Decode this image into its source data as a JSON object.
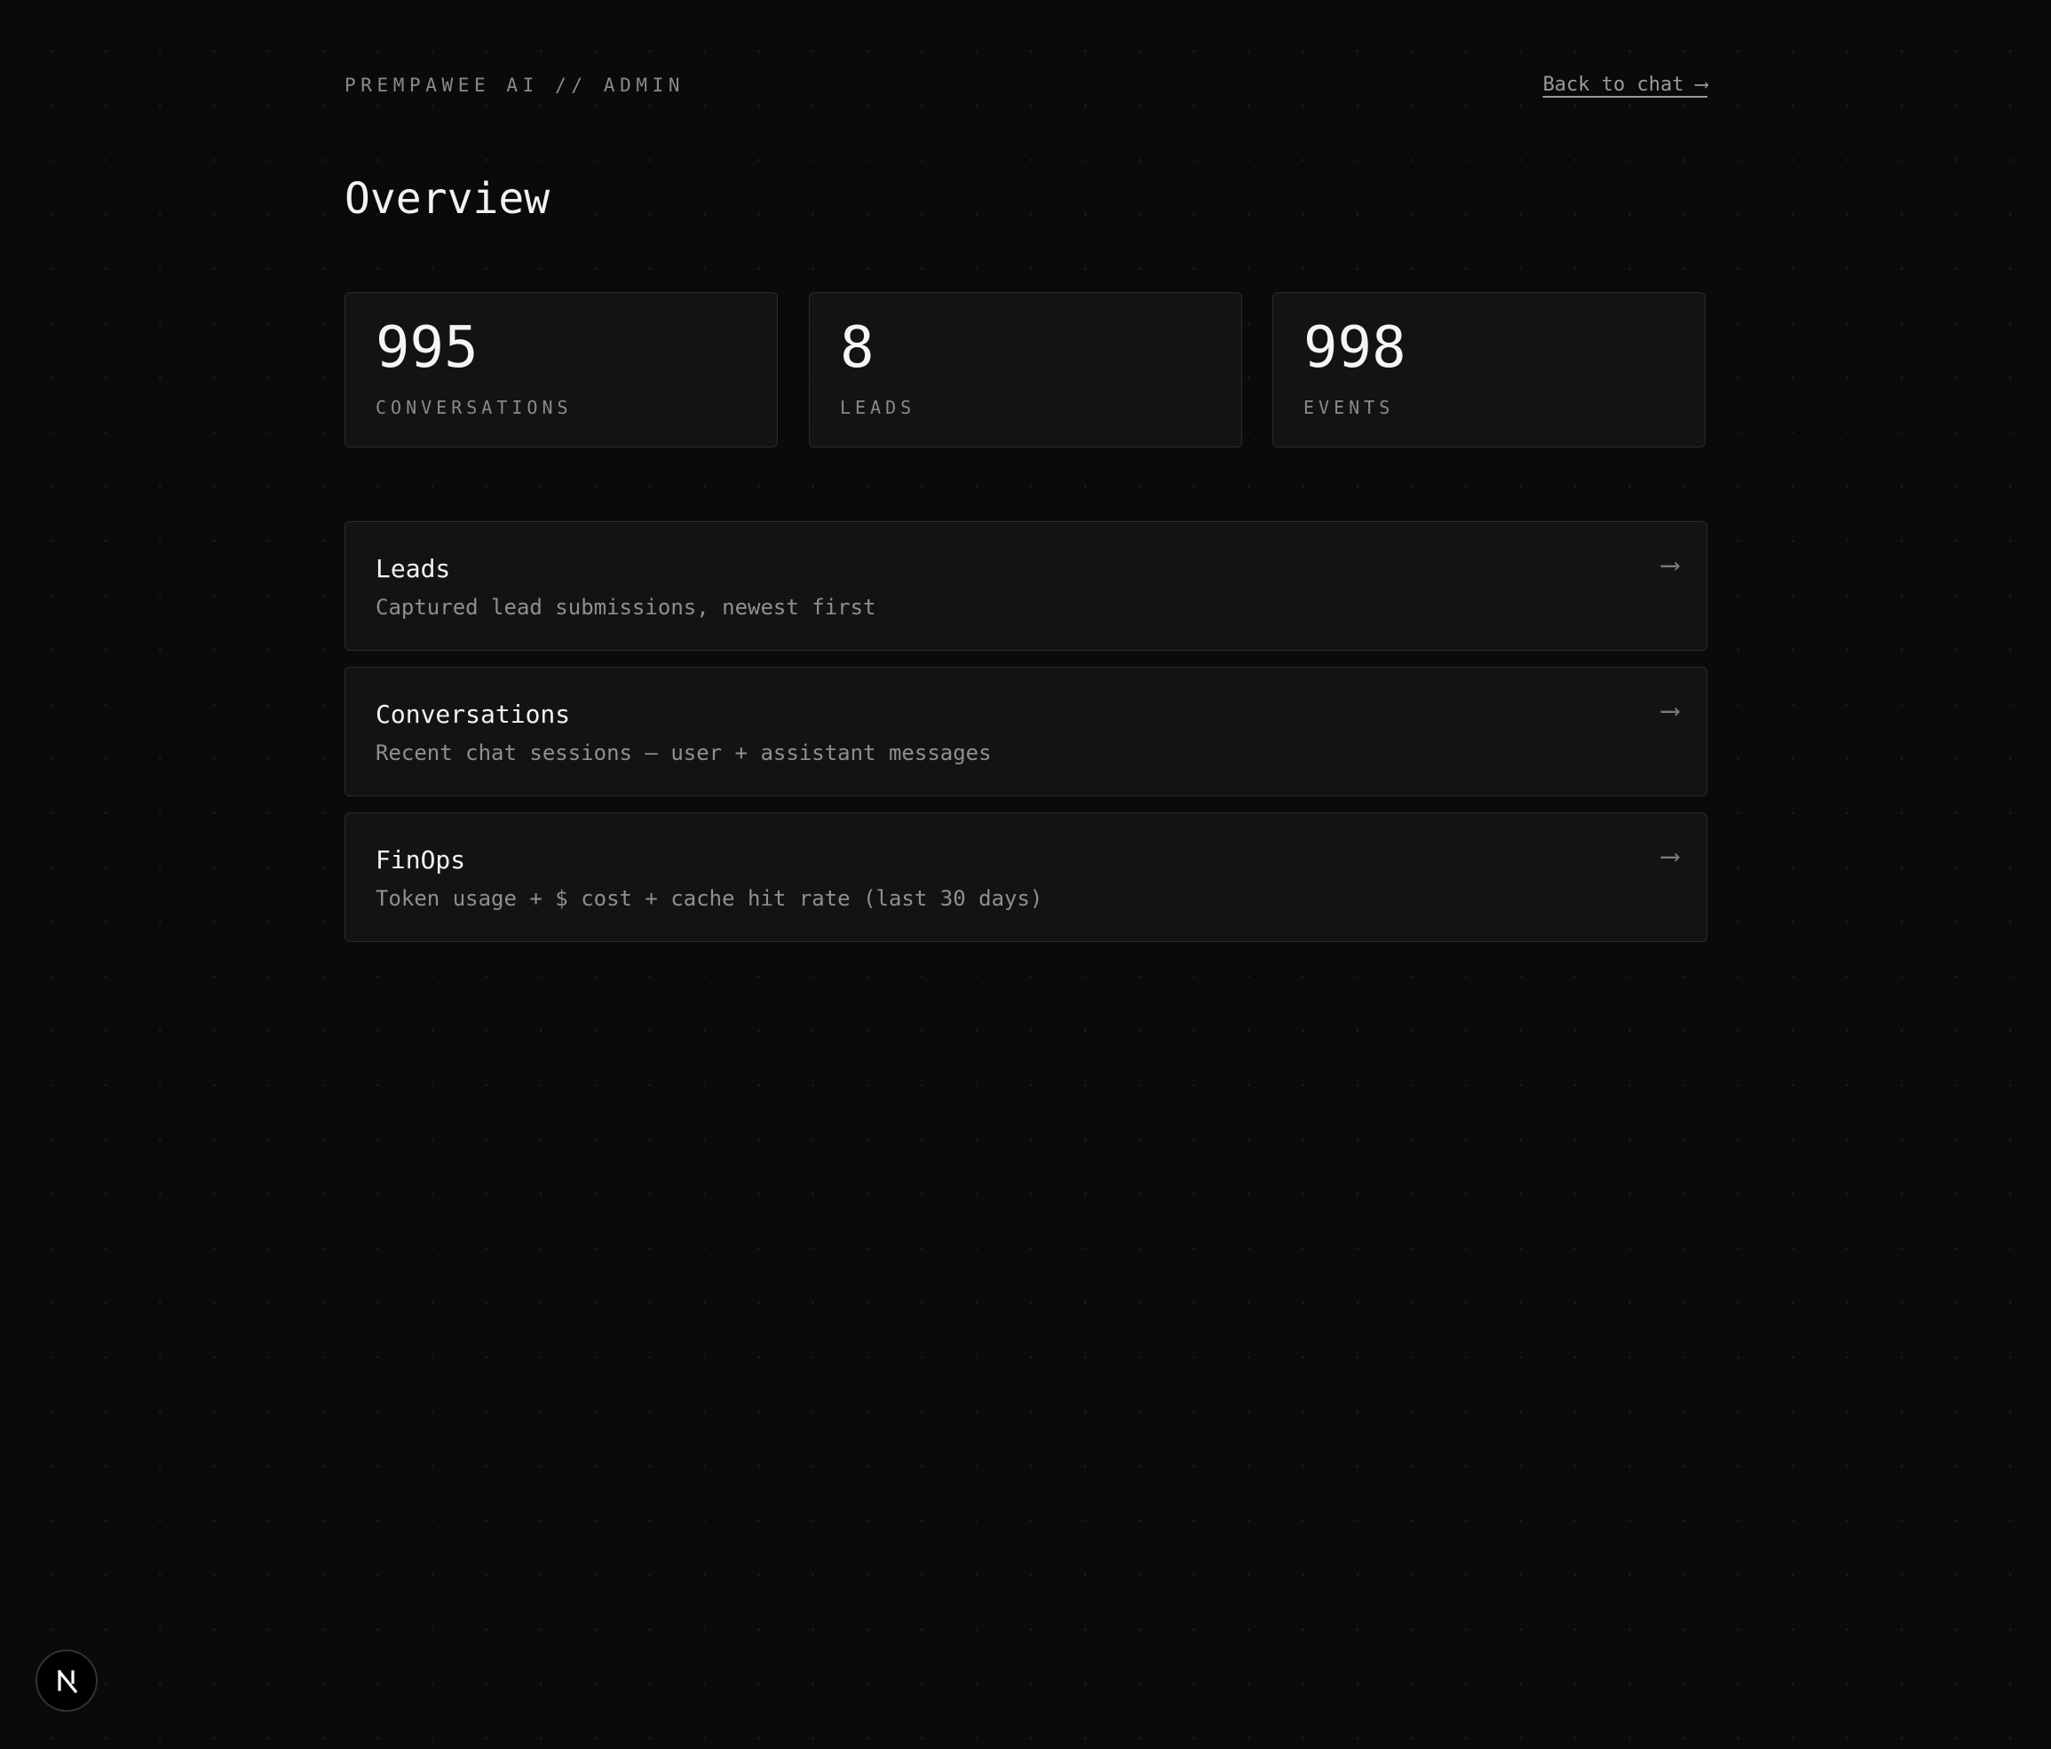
{
  "header": {
    "brand": "PREMPAWEE AI // ADMIN",
    "back_link": "Back to chat ⟶"
  },
  "page_title": "Overview",
  "stats": [
    {
      "value": "995",
      "label": "CONVERSATIONS"
    },
    {
      "value": "8",
      "label": "LEADS"
    },
    {
      "value": "998",
      "label": "EVENTS"
    }
  ],
  "nav_cards": [
    {
      "title": "Leads",
      "description": "Captured lead submissions, newest first",
      "arrow": "⟶"
    },
    {
      "title": "Conversations",
      "description": "Recent chat sessions — user + assistant messages",
      "arrow": "⟶"
    },
    {
      "title": "FinOps",
      "description": "Token usage + $ cost + cache hit rate (last 30 days)",
      "arrow": "⟶"
    }
  ],
  "dev_badge": {
    "icon": "nextjs-logo-icon"
  },
  "colors": {
    "background": "#0a0a0a",
    "card_border": "#2b2b2b",
    "text_primary": "#f2f2f2",
    "text_muted": "#8a8a8a"
  }
}
